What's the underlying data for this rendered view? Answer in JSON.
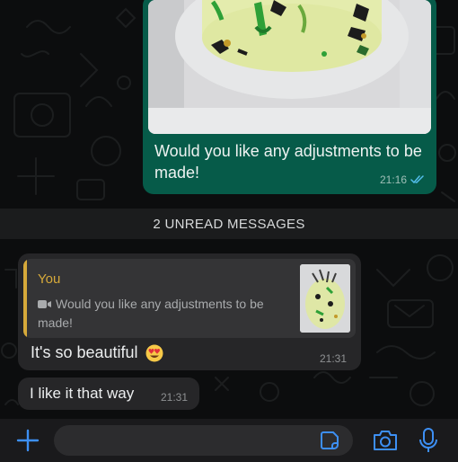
{
  "colors": {
    "outgoing_bubble": "#065b49",
    "incoming_bubble": "#262628",
    "quote_accent": "#d6a93a",
    "icon_accent": "#3d8ff3",
    "read_ticks": "#53bdeb"
  },
  "outgoing_message": {
    "media": "cake-photo",
    "caption": "Would you like any adjustments to be made!",
    "time": "21:16",
    "status_icon": "double-check-icon"
  },
  "unread_divider": {
    "label": "2 UNREAD MESSAGES"
  },
  "incoming_messages": [
    {
      "reply_to": {
        "author": "You",
        "type_icon": "video-icon",
        "text": "Would you like any adjustments to be made!",
        "thumbnail": "cake-thumbnail"
      },
      "text": "It's so beautiful",
      "emoji": "heart-eyes-emoji",
      "time": "21:31"
    },
    {
      "text": "I like it that way",
      "time": "21:31"
    }
  ],
  "composer": {
    "placeholder": "",
    "icons": [
      "plus-icon",
      "sticker-icon",
      "camera-icon",
      "microphone-icon"
    ]
  }
}
